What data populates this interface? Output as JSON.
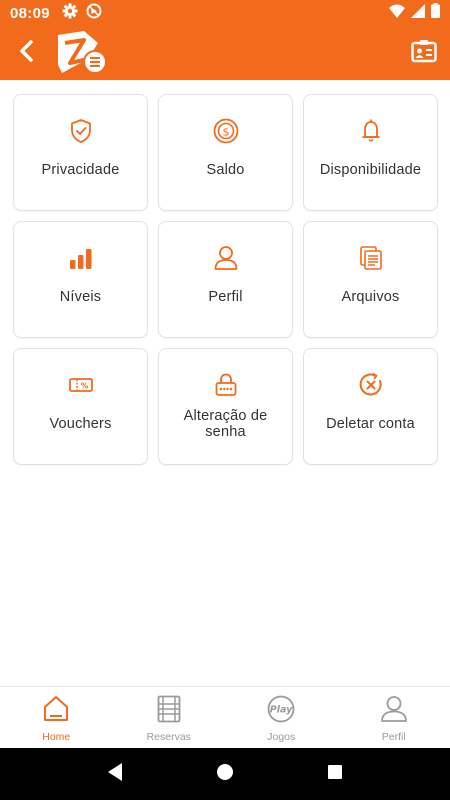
{
  "status_bar": {
    "time": "08:09",
    "icons": [
      "gear-icon",
      "no-sim-icon"
    ],
    "right_icons": [
      "wifi-icon",
      "signal-icon",
      "battery-icon"
    ]
  },
  "app_bar": {
    "back_icon": "chevron-left-icon",
    "logo": "app-logo",
    "action_icon": "id-card-icon",
    "color": "#f26a1b"
  },
  "tiles": [
    {
      "label": "Privacidade",
      "icon": "shield-check-icon"
    },
    {
      "label": "Saldo",
      "icon": "coin-icon"
    },
    {
      "label": "Disponibilidade",
      "icon": "bell-icon"
    },
    {
      "label": "Níveis",
      "icon": "bar-chart-icon"
    },
    {
      "label": "Perfil",
      "icon": "user-icon"
    },
    {
      "label": "Arquivos",
      "icon": "files-icon"
    },
    {
      "label": "Vouchers",
      "icon": "voucher-icon"
    },
    {
      "label": "Alteração de senha",
      "icon": "lock-password-icon"
    },
    {
      "label": "Deletar conta",
      "icon": "delete-circle-icon"
    }
  ],
  "bottom_nav": [
    {
      "label": "Home",
      "icon": "home-icon",
      "active": true
    },
    {
      "label": "Reservas",
      "icon": "calendar-grid-icon",
      "active": false
    },
    {
      "label": "Jogos",
      "icon": "play-badge-icon",
      "active": false,
      "icon_text": "Play"
    },
    {
      "label": "Perfil",
      "icon": "person-icon",
      "active": false
    }
  ],
  "system_nav": [
    "back-triangle-icon",
    "home-circle-icon",
    "recents-square-icon"
  ],
  "colors": {
    "accent": "#f26a1b",
    "inactive": "#9a9a9a",
    "text": "#333333"
  }
}
